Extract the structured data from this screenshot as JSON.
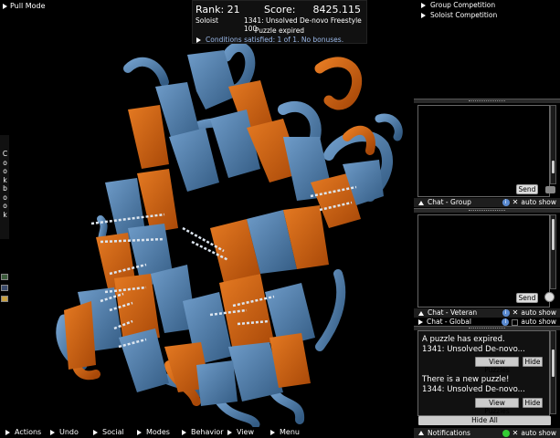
{
  "top_left": {
    "pull_mode_label": "Pull Mode"
  },
  "score_panel": {
    "rank": "Rank: 21",
    "score_label": "Score:",
    "score_value": "8425.115",
    "mode": "Soloist",
    "puzzle_title": "1341: Unsolved De-novo Freestyle 100",
    "status": "Puzzle expired",
    "conditions": "Conditions satisfied: 1 of 1. No bonuses."
  },
  "cookbook": {
    "label": "Cookbook",
    "letters": [
      "C",
      "o",
      "o",
      "k",
      "b",
      "o",
      "o",
      "k"
    ]
  },
  "competitions": {
    "group": "Group Competition",
    "soloist": "Soloist Competition"
  },
  "chat_group": {
    "send_label": "Send",
    "footer_label": "Chat - Group",
    "auto_show": "auto show"
  },
  "chat_veteran": {
    "send_label": "Send",
    "footer_label": "Chat - Veteran",
    "auto_show": "auto show"
  },
  "chat_global": {
    "footer_label": "Chat - Global",
    "auto_show": "auto show"
  },
  "notifications": {
    "messages": [
      {
        "line1": "A puzzle has expired.",
        "line2": "1341: Unsolved De-novo...",
        "view_label": "View Puzzles",
        "hide_label": "Hide"
      },
      {
        "line1": "There is a new puzzle!",
        "line2": "1344: Unsolved De-novo...",
        "view_label": "View Puzzles",
        "hide_label": "Hide"
      }
    ],
    "hide_all_label": "Hide All",
    "footer_label": "Notifications",
    "auto_show": "auto show"
  },
  "bottom_menu": {
    "items": [
      "Actions",
      "Undo",
      "Social",
      "Modes",
      "Behavior",
      "View",
      "Menu"
    ]
  },
  "colors": {
    "strand_orange": "#d4640f",
    "strand_blue": "#4a7ba8",
    "loop_blue": "#5b86b4",
    "hbond": "#dde6f0",
    "info_blue": "#5a8ad0",
    "conditions_text": "#9ab8e8",
    "notif_green": "#33cc33"
  },
  "icons": [
    "triangle-right-icon",
    "triangle-up-icon",
    "info-icon",
    "camera-icon",
    "clock-icon",
    "close-icon",
    "check-icon"
  ]
}
